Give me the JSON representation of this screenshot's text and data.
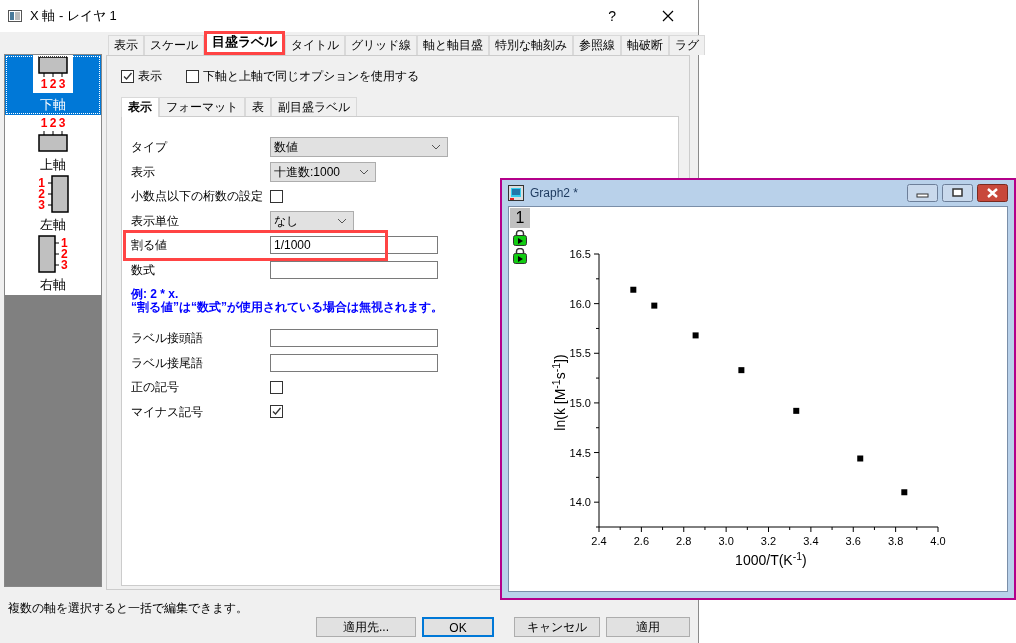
{
  "dialog": {
    "title": "X 軸 - レイヤ 1",
    "help": "?"
  },
  "axes": [
    {
      "kind": "bottom",
      "label": "下軸",
      "ticks": [
        "1",
        "2",
        "3"
      ],
      "selected": true
    },
    {
      "kind": "top",
      "label": "上軸",
      "ticks": [
        "1",
        "2",
        "3"
      ],
      "selected": false
    },
    {
      "kind": "left",
      "label": "左軸",
      "ticks": [
        "1",
        "2",
        "3"
      ],
      "selected": false
    },
    {
      "kind": "right",
      "label": "右軸",
      "ticks": [
        "1",
        "2",
        "3"
      ],
      "selected": false
    }
  ],
  "tabs": [
    {
      "label": "表示",
      "selected": false
    },
    {
      "label": "スケール",
      "selected": false
    },
    {
      "label": "目盛ラベル",
      "selected": true
    },
    {
      "label": "タイトル",
      "selected": false
    },
    {
      "label": "グリッド線",
      "selected": false
    },
    {
      "label": "軸と軸目盛",
      "selected": false
    },
    {
      "label": "特別な軸刻み",
      "selected": false
    },
    {
      "label": "参照線",
      "selected": false
    },
    {
      "label": "軸破断",
      "selected": false
    },
    {
      "label": "ラグ",
      "selected": false
    }
  ],
  "options": [
    {
      "label": "表示",
      "checked": true
    },
    {
      "label": "下軸と上軸で同じオプションを使用する",
      "checked": false
    }
  ],
  "subtabs": [
    {
      "label": "表示",
      "selected": true
    },
    {
      "label": "フォーマット",
      "selected": false
    },
    {
      "label": "表",
      "selected": false
    },
    {
      "label": "副目盛ラベル",
      "selected": false
    }
  ],
  "rows": [
    {
      "kind": "select",
      "label": "タイプ",
      "value": "数値",
      "highlighted": false
    },
    {
      "kind": "select",
      "label": "表示",
      "value": "十進数:1000",
      "highlighted": false
    },
    {
      "kind": "checkbox",
      "label": "小数点以下の桁数の設定",
      "checked": false,
      "highlighted": false
    },
    {
      "kind": "select",
      "label": "表示単位",
      "value": "なし",
      "highlighted": false
    },
    {
      "kind": "text",
      "label": "割る値",
      "value": "1/1000",
      "highlighted": true
    },
    {
      "kind": "text",
      "label": "数式",
      "highlighted": false
    },
    {
      "kind": "note",
      "lines": [
        "例: 2 * x.",
        "“割る値”は“数式”が使用されている場合は無視されます。"
      ],
      "highlighted": false
    },
    {
      "kind": "text",
      "label": "ラベル接頭語",
      "highlighted": false
    },
    {
      "kind": "text",
      "label": "ラベル接尾語",
      "highlighted": false
    },
    {
      "kind": "checkbox",
      "label": "正の記号",
      "checked": false,
      "highlighted": false
    },
    {
      "kind": "checkbox",
      "label": "マイナス記号",
      "checked": true,
      "highlighted": false
    }
  ],
  "status_bar": "複数の軸を選択すると一括で編集できます。",
  "buttons": [
    {
      "label": "適用先...",
      "default": false
    },
    {
      "label": "OK",
      "default": true
    },
    {
      "label": "キャンセル",
      "default": false
    },
    {
      "label": "適用",
      "default": false
    }
  ],
  "graph_window": {
    "title": "Graph2 *",
    "layer": "1",
    "chart_data": {
      "type": "scatter",
      "xlabel": "1000/T(K$^{-1}$)",
      "ylabel": "ln(k [M$^{-1}$s$^{-1}$])",
      "x": [
        2.562,
        2.661,
        2.856,
        3.072,
        3.331,
        3.633,
        3.841
      ],
      "series": [
        {
          "color": "#000000",
          "values": [
            16.14,
            15.98,
            15.68,
            15.33,
            14.92,
            14.44,
            14.1
          ]
        }
      ],
      "xlim": [
        2.4,
        4.0
      ],
      "ylim": [
        13.75,
        16.5
      ],
      "xticks": [
        {
          "value": 2.4,
          "label": "2.4"
        },
        {
          "value": 2.6,
          "label": "2.6"
        },
        {
          "value": 2.8,
          "label": "2.8"
        },
        {
          "value": 3.0,
          "label": "3.0"
        },
        {
          "value": 3.2,
          "label": "3.2"
        },
        {
          "value": 3.4,
          "label": "3.4"
        },
        {
          "value": 3.6,
          "label": "3.6"
        },
        {
          "value": 3.8,
          "label": "3.8"
        },
        {
          "value": 4.0,
          "label": "4.0"
        }
      ],
      "yticks": [
        {
          "value": 14.0,
          "label": "14.0"
        },
        {
          "value": 14.5,
          "label": "14.5"
        },
        {
          "value": 15.0,
          "label": "15.0"
        },
        {
          "value": 15.5,
          "label": "15.5"
        },
        {
          "value": 16.0,
          "label": "16.0"
        },
        {
          "value": 16.5,
          "label": "16.5"
        }
      ]
    }
  }
}
